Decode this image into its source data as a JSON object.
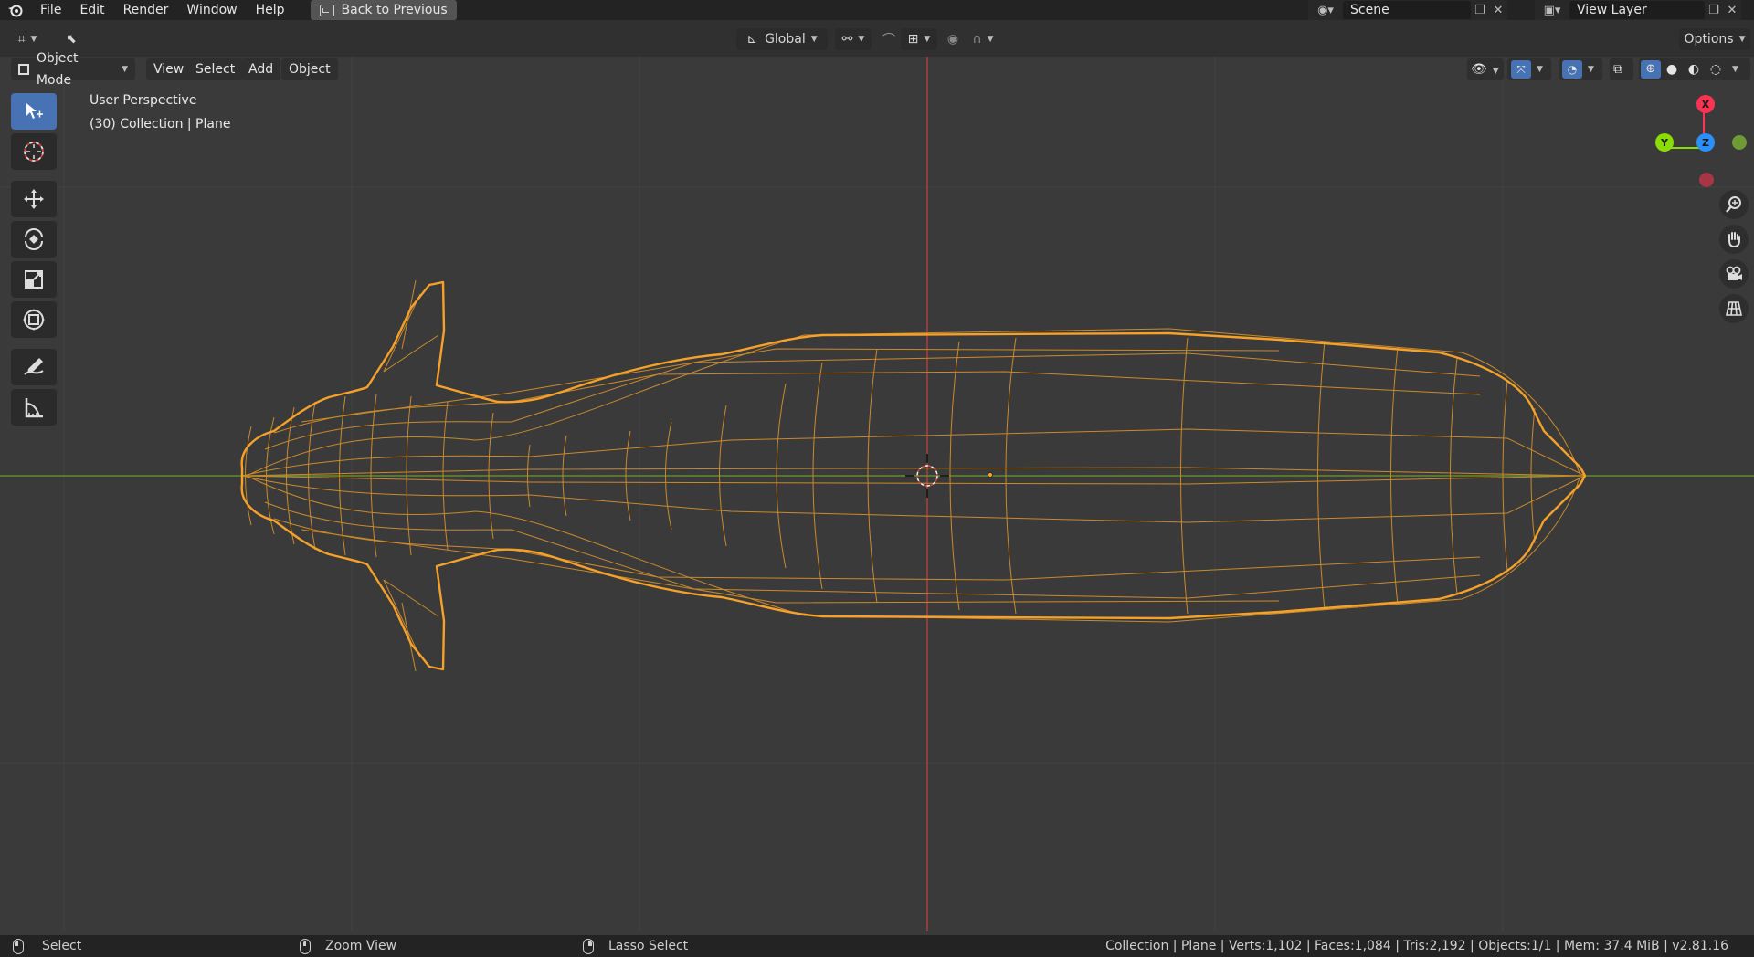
{
  "menubar": {
    "items": [
      "File",
      "Edit",
      "Render",
      "Window",
      "Help"
    ],
    "back_button": "Back to Previous",
    "scene": "Scene",
    "view_layer": "View Layer"
  },
  "header": {
    "orientation": "Global",
    "options": "Options"
  },
  "viewport_header": {
    "mode": "Object Mode",
    "menus": [
      "View",
      "Select",
      "Add",
      "Object"
    ]
  },
  "overlay": {
    "perspective": "User Perspective",
    "collection": "(30) Collection | Plane"
  },
  "gizmo": {
    "x_label": "X",
    "y_label": "Y",
    "z_label": "Z",
    "x_color": "#ff3352",
    "y_color": "#8bdc00",
    "z_color": "#2890ff"
  },
  "statusbar": {
    "select": "Select",
    "zoom_view": "Zoom View",
    "lasso_select": "Lasso Select",
    "stats": "Collection | Plane | Verts:1,102 | Faces:1,084 | Tris:2,192 | Objects:1/1 | Mem: 37.4 MiB | v2.81.16"
  },
  "colors": {
    "selection_outline": "#f5a12a",
    "active_tool": "#4772b3",
    "x_axis": "#b8423f",
    "y_axis": "#6c9a28"
  }
}
